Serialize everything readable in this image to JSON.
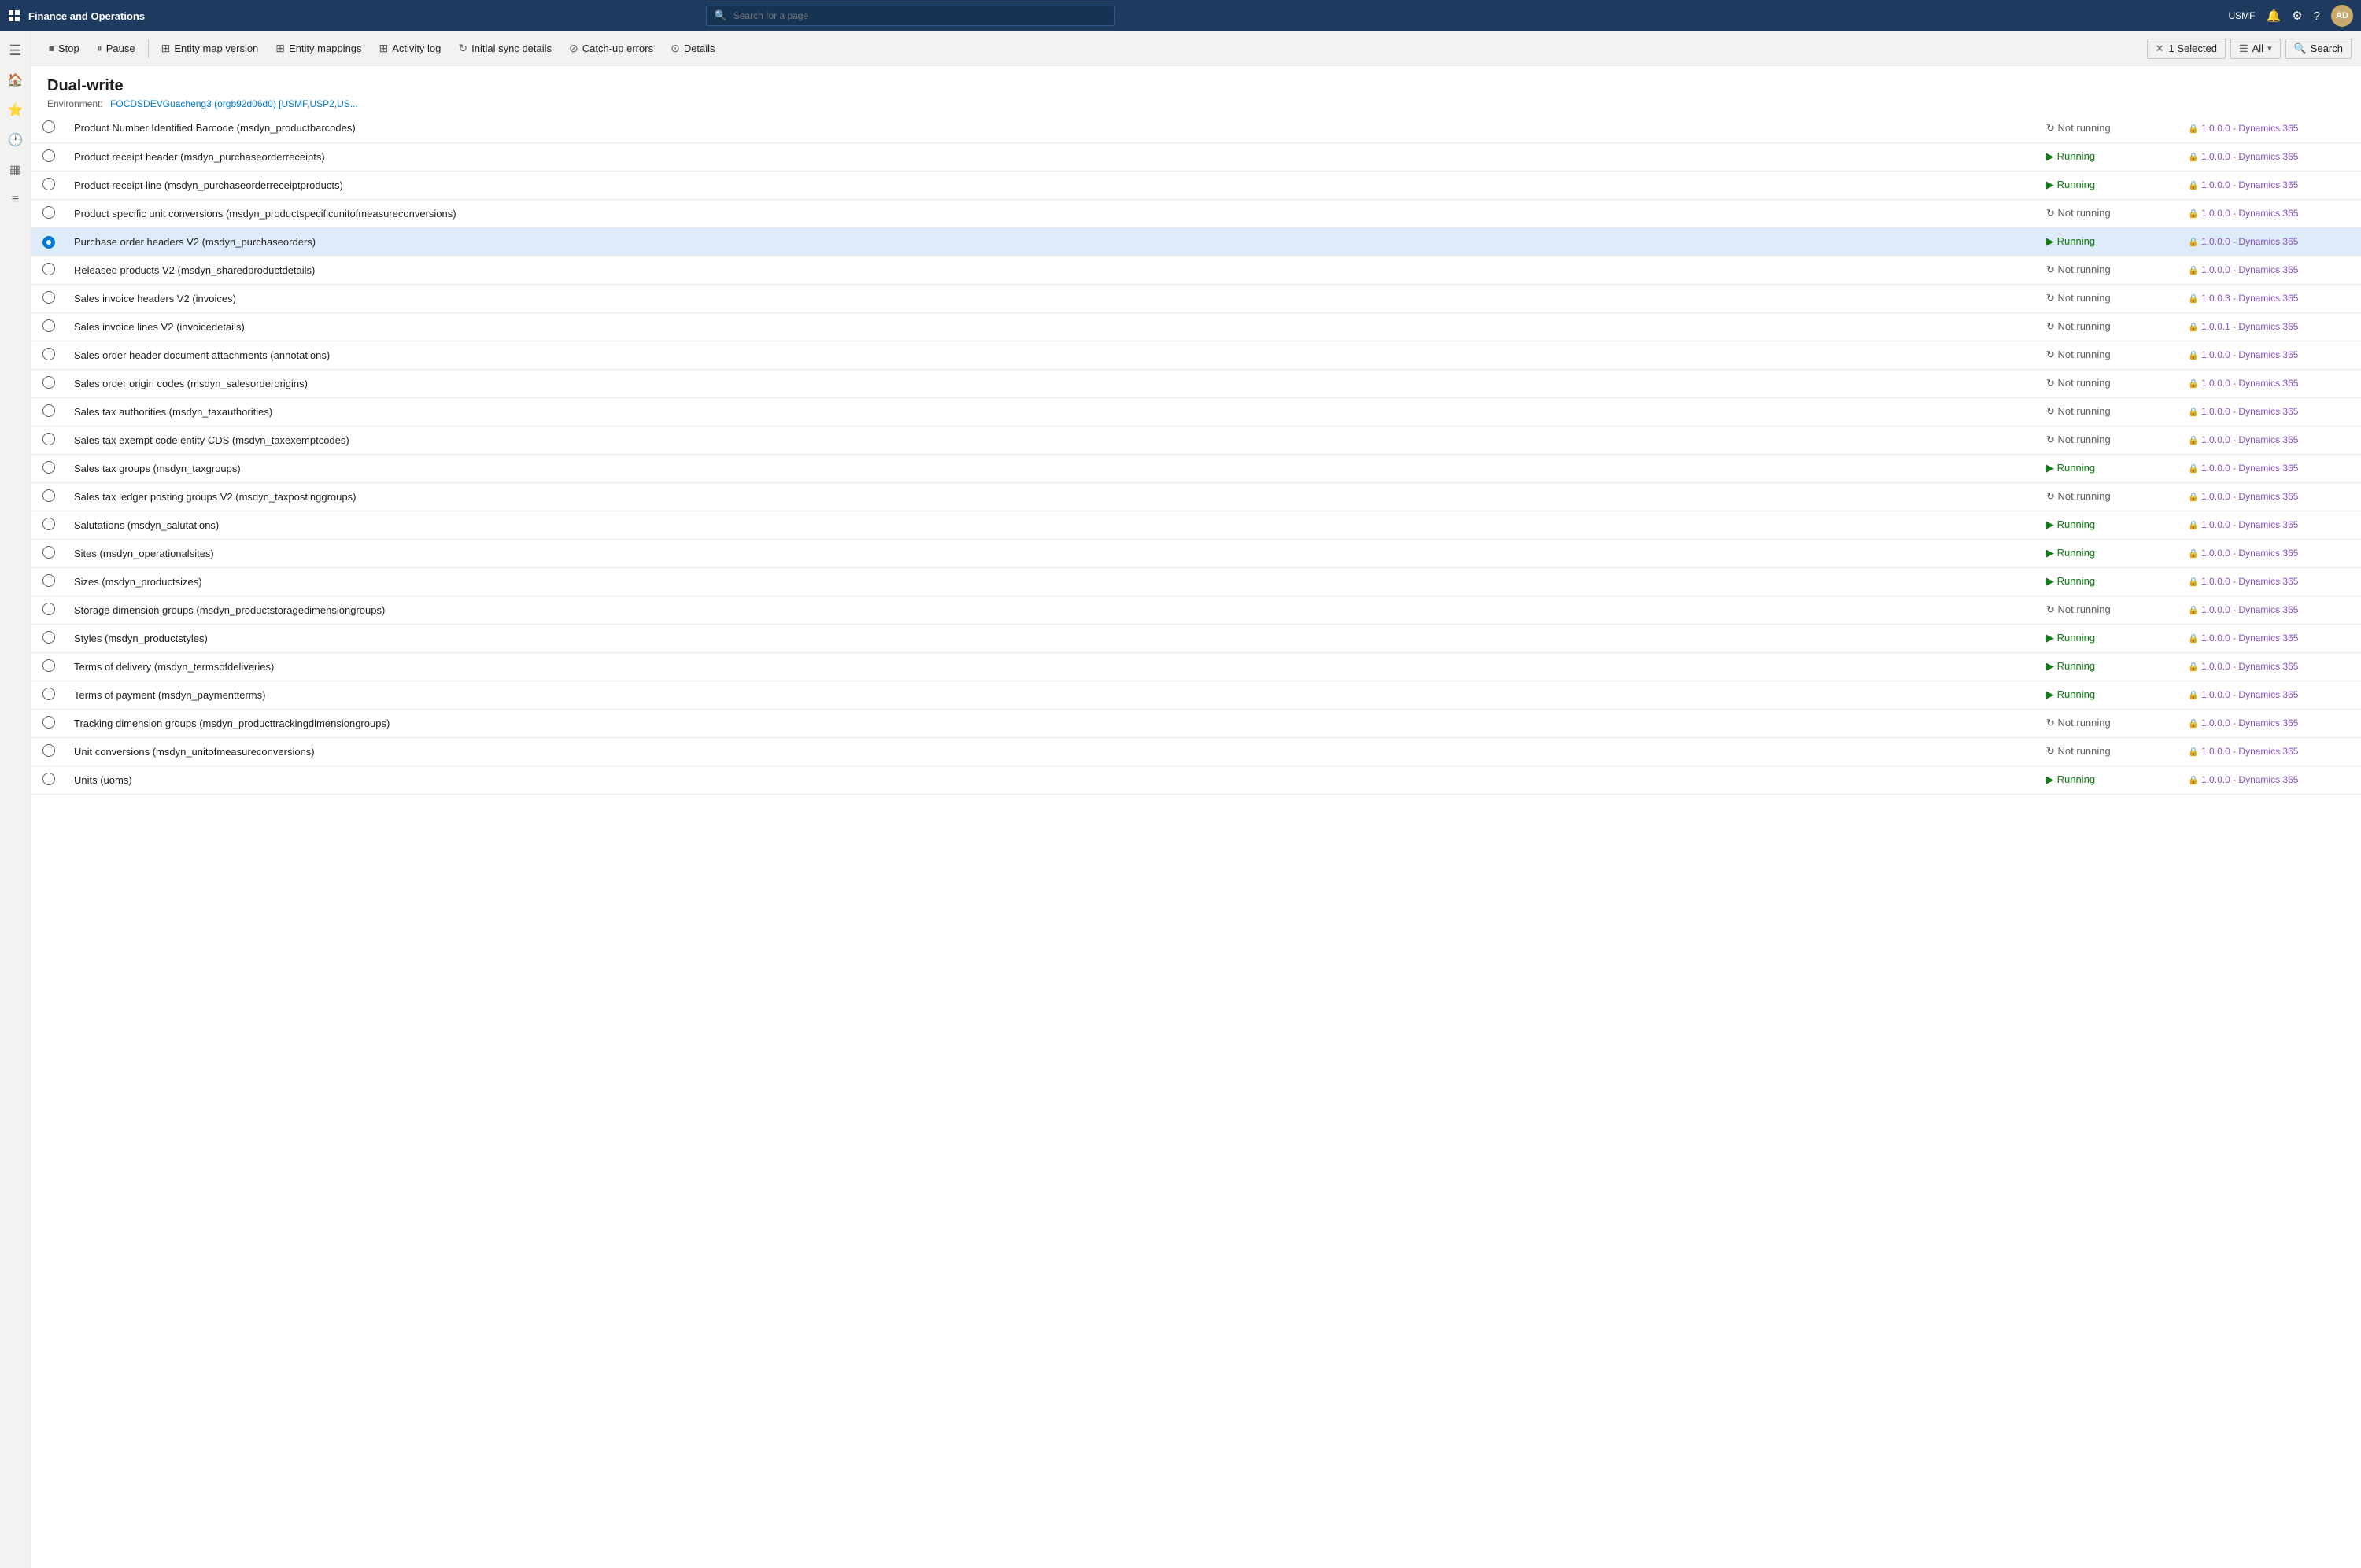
{
  "app": {
    "name": "Finance and Operations",
    "search_placeholder": "Search for a page",
    "user_code": "USMF",
    "avatar_initials": "AD"
  },
  "toolbar": {
    "stop_label": "Stop",
    "pause_label": "Pause",
    "entity_map_version_label": "Entity map version",
    "entity_mappings_label": "Entity mappings",
    "activity_log_label": "Activity log",
    "initial_sync_label": "Initial sync details",
    "catchup_label": "Catch-up errors",
    "details_label": "Details",
    "selected_label": "1 Selected",
    "filter_label": "All",
    "search_label": "Search"
  },
  "page": {
    "title": "Dual-write",
    "env_label": "Environment:",
    "env_value": "FOCDSDEVGuacheng3 (orgb92d06d0) [USMF,USP2,US..."
  },
  "rows": [
    {
      "name": "Product Number Identified Barcode (msdyn_productbarcodes)",
      "status": "Not running",
      "version": "1.0.0.0 - Dynamics 365",
      "selected": false
    },
    {
      "name": "Product receipt header (msdyn_purchaseorderreceipts)",
      "status": "Running",
      "version": "1.0.0.0 - Dynamics 365",
      "selected": false
    },
    {
      "name": "Product receipt line (msdyn_purchaseorderreceiptproducts)",
      "status": "Running",
      "version": "1.0.0.0 - Dynamics 365",
      "selected": false
    },
    {
      "name": "Product specific unit conversions (msdyn_productspecificunitofmeasureconversions)",
      "status": "Not running",
      "version": "1.0.0.0 - Dynamics 365",
      "selected": false
    },
    {
      "name": "Purchase order headers V2 (msdyn_purchaseorders)",
      "status": "Running",
      "version": "1.0.0.0 - Dynamics 365",
      "selected": true
    },
    {
      "name": "Released products V2 (msdyn_sharedproductdetails)",
      "status": "Not running",
      "version": "1.0.0.0 - Dynamics 365",
      "selected": false
    },
    {
      "name": "Sales invoice headers V2 (invoices)",
      "status": "Not running",
      "version": "1.0.0.3 - Dynamics 365",
      "selected": false
    },
    {
      "name": "Sales invoice lines V2 (invoicedetails)",
      "status": "Not running",
      "version": "1.0.0.1 - Dynamics 365",
      "selected": false
    },
    {
      "name": "Sales order header document attachments (annotations)",
      "status": "Not running",
      "version": "1.0.0.0 - Dynamics 365",
      "selected": false
    },
    {
      "name": "Sales order origin codes (msdyn_salesorderorigins)",
      "status": "Not running",
      "version": "1.0.0.0 - Dynamics 365",
      "selected": false
    },
    {
      "name": "Sales tax authorities (msdyn_taxauthorities)",
      "status": "Not running",
      "version": "1.0.0.0 - Dynamics 365",
      "selected": false
    },
    {
      "name": "Sales tax exempt code entity CDS (msdyn_taxexemptcodes)",
      "status": "Not running",
      "version": "1.0.0.0 - Dynamics 365",
      "selected": false
    },
    {
      "name": "Sales tax groups (msdyn_taxgroups)",
      "status": "Running",
      "version": "1.0.0.0 - Dynamics 365",
      "selected": false
    },
    {
      "name": "Sales tax ledger posting groups V2 (msdyn_taxpostinggroups)",
      "status": "Not running",
      "version": "1.0.0.0 - Dynamics 365",
      "selected": false
    },
    {
      "name": "Salutations (msdyn_salutations)",
      "status": "Running",
      "version": "1.0.0.0 - Dynamics 365",
      "selected": false
    },
    {
      "name": "Sites (msdyn_operationalsites)",
      "status": "Running",
      "version": "1.0.0.0 - Dynamics 365",
      "selected": false
    },
    {
      "name": "Sizes (msdyn_productsizes)",
      "status": "Running",
      "version": "1.0.0.0 - Dynamics 365",
      "selected": false
    },
    {
      "name": "Storage dimension groups (msdyn_productstoragedimensiongroups)",
      "status": "Not running",
      "version": "1.0.0.0 - Dynamics 365",
      "selected": false
    },
    {
      "name": "Styles (msdyn_productstyles)",
      "status": "Running",
      "version": "1.0.0.0 - Dynamics 365",
      "selected": false
    },
    {
      "name": "Terms of delivery (msdyn_termsofdeliveries)",
      "status": "Running",
      "version": "1.0.0.0 - Dynamics 365",
      "selected": false
    },
    {
      "name": "Terms of payment (msdyn_paymentterms)",
      "status": "Running",
      "version": "1.0.0.0 - Dynamics 365",
      "selected": false
    },
    {
      "name": "Tracking dimension groups (msdyn_producttrackingdimensiongroups)",
      "status": "Not running",
      "version": "1.0.0.0 - Dynamics 365",
      "selected": false
    },
    {
      "name": "Unit conversions (msdyn_unitofmeasureconversions)",
      "status": "Not running",
      "version": "1.0.0.0 - Dynamics 365",
      "selected": false
    },
    {
      "name": "Units (uoms)",
      "status": "Running",
      "version": "1.0.0.0 - Dynamics 365",
      "selected": false
    }
  ]
}
